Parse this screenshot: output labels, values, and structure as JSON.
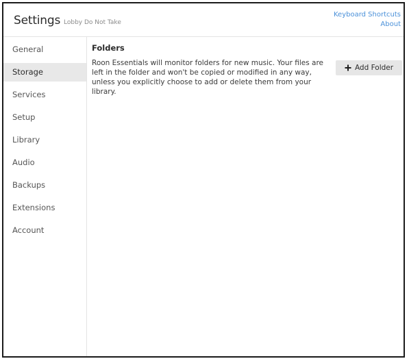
{
  "header": {
    "title": "Settings",
    "subtitle": "Lobby Do Not Take",
    "links": {
      "keyboard_shortcuts": "Keyboard Shortcuts",
      "about": "About"
    }
  },
  "sidebar": {
    "active": "Storage",
    "items": [
      {
        "label": "General"
      },
      {
        "label": "Storage"
      },
      {
        "label": "Services"
      },
      {
        "label": "Setup"
      },
      {
        "label": "Library"
      },
      {
        "label": "Audio"
      },
      {
        "label": "Backups"
      },
      {
        "label": "Extensions"
      },
      {
        "label": "Account"
      }
    ]
  },
  "main": {
    "section_title": "Folders",
    "description": "Roon Essentials will monitor folders for new music. Your files are left in the folder and won't be copied or modified in any way, unless you explicitly choose to add or delete them from your library.",
    "add_folder_label": "Add Folder",
    "add_folder_icon": "plus-icon"
  },
  "colors": {
    "link": "#4a90d9",
    "active_nav_bg": "#e8e8e8",
    "button_bg": "#e6e6e6"
  }
}
